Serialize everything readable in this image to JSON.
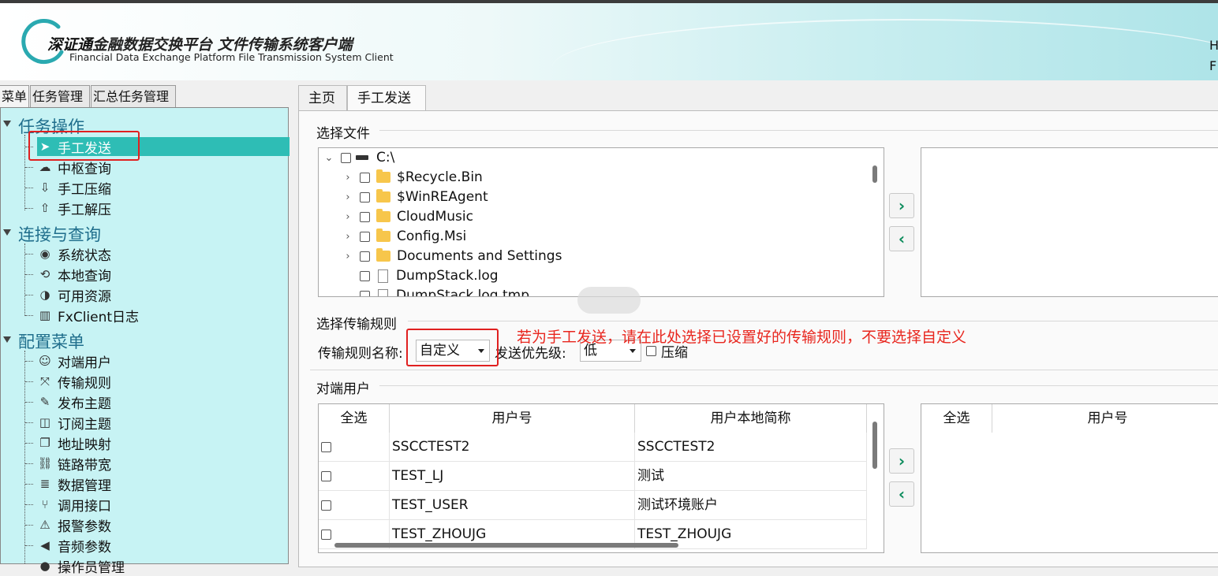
{
  "header": {
    "brand": "深证通",
    "title_cn": "金融数据交换平台  文件传输系统客户端",
    "title_en": "Financial Data Exchange Platform File Transmission System Client",
    "right_text_1": "H",
    "right_text_2": "F"
  },
  "left_tabs": [
    "菜单",
    "任务管理",
    "汇总任务管理"
  ],
  "menu": {
    "groups": [
      {
        "label": "任务操作",
        "items": [
          "手工发送",
          "中枢查询",
          "手工压缩",
          "手工解压"
        ]
      },
      {
        "label": "连接与查询",
        "items": [
          "系统状态",
          "本地查询",
          "可用资源",
          "FxClient日志"
        ]
      },
      {
        "label": "配置菜单",
        "items": [
          "对端用户",
          "传输规则",
          "发布主题",
          "订阅主题",
          "地址映射",
          "链路带宽",
          "数据管理",
          "调用接口",
          "报警参数",
          "音频参数",
          "操作员管理"
        ]
      }
    ],
    "selected": "手工发送"
  },
  "right_tabs": [
    "主页",
    "手工发送"
  ],
  "select_file": {
    "title": "选择文件",
    "root": "C:\\",
    "entries": [
      {
        "name": "$Recycle.Bin",
        "type": "folder"
      },
      {
        "name": "$WinREAgent",
        "type": "folder"
      },
      {
        "name": "CloudMusic",
        "type": "folder"
      },
      {
        "name": "Config.Msi",
        "type": "folder"
      },
      {
        "name": "Documents and Settings",
        "type": "folder"
      },
      {
        "name": "DumpStack.log",
        "type": "file"
      },
      {
        "name": "DumpStack.log.tmp",
        "type": "file"
      }
    ]
  },
  "rule": {
    "title": "选择传输规则",
    "name_label": "传输规则名称:",
    "name_value": "自定义",
    "priority_label": "发送优先级:",
    "priority_value": "低",
    "compress_label": "压缩",
    "annotation": "若为手工发送，请在此处选择已设置好的传输规则，不要选择自定义"
  },
  "peer": {
    "title": "对端用户",
    "columns": [
      "全选",
      "用户号",
      "用户本地简称"
    ],
    "rows": [
      {
        "id": "SSCCTEST2",
        "alias": "SSCCTEST2"
      },
      {
        "id": "TEST_LJ",
        "alias": "测试"
      },
      {
        "id": "TEST_USER",
        "alias": "测试环境账户"
      },
      {
        "id": "TEST_ZHOUJG",
        "alias": "TEST_ZHOUJG"
      }
    ],
    "right_columns": [
      "全选",
      "用户号"
    ]
  },
  "colors": {
    "accent": "#2ebdb5",
    "panel": "#c7f3f4",
    "annotation": "#e8261e",
    "arrow": "#0c8c5c"
  }
}
